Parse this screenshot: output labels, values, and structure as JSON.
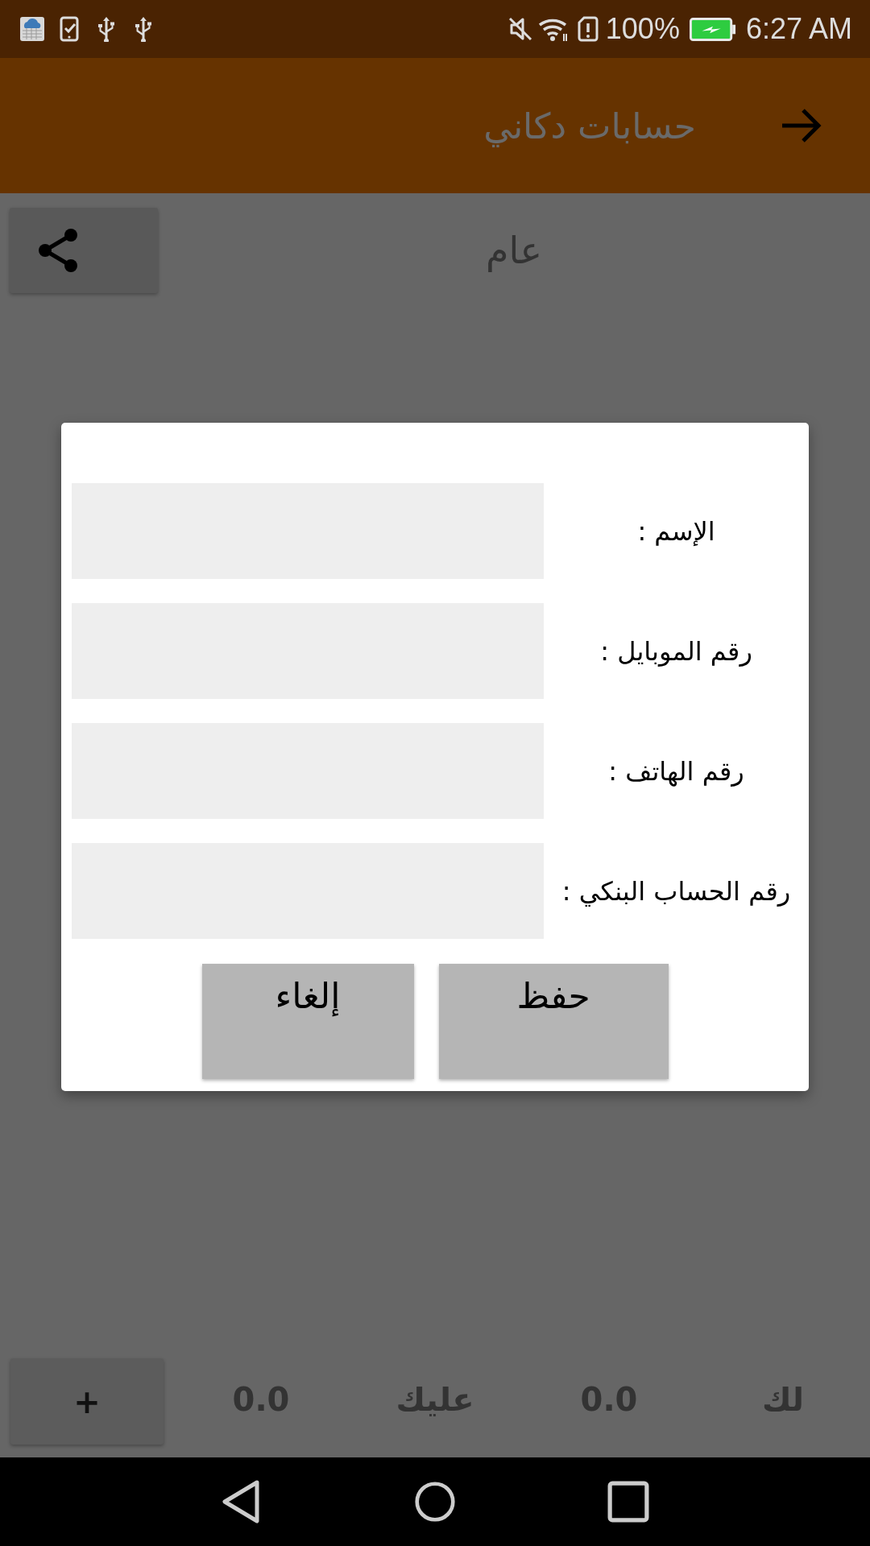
{
  "status_bar": {
    "battery": "100%",
    "time": "6:27 AM"
  },
  "app_bar": {
    "title": "حسابات دكاني"
  },
  "header": {
    "title": "عام"
  },
  "dialog": {
    "fields": [
      {
        "label": "الإسم :"
      },
      {
        "label": "رقم الموبايل :"
      },
      {
        "label": "رقم الهاتف :"
      },
      {
        "label": "رقم الحساب البنكي :"
      }
    ],
    "buttons": [
      {
        "label": "حفظ"
      },
      {
        "label": "إلغاء"
      }
    ]
  },
  "bottom_bar": {
    "add_button": "+",
    "totals": [
      {
        "label": "لك",
        "value": "0.0"
      },
      {
        "label": "عليك",
        "value": "0.0"
      }
    ]
  }
}
